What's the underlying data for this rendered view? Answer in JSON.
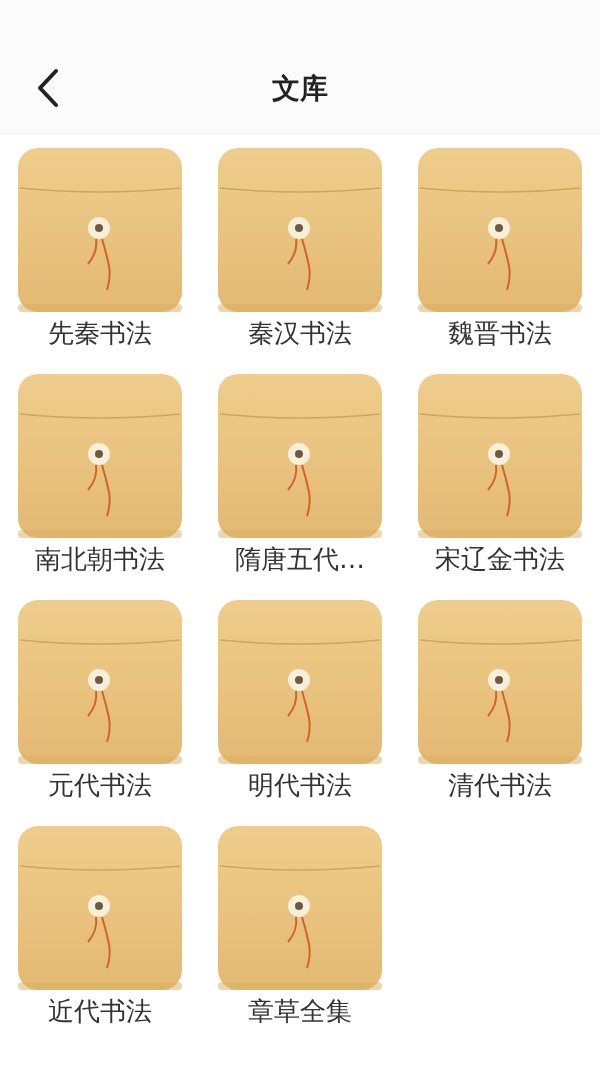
{
  "header": {
    "title": "文库"
  },
  "folders": [
    {
      "label": "先秦书法"
    },
    {
      "label": "秦汉书法"
    },
    {
      "label": "魏晋书法"
    },
    {
      "label": "南北朝书法"
    },
    {
      "label": "隋唐五代…"
    },
    {
      "label": "宋辽金书法"
    },
    {
      "label": "元代书法"
    },
    {
      "label": "明代书法"
    },
    {
      "label": "清代书法"
    },
    {
      "label": "近代书法"
    },
    {
      "label": "章草全集"
    }
  ]
}
